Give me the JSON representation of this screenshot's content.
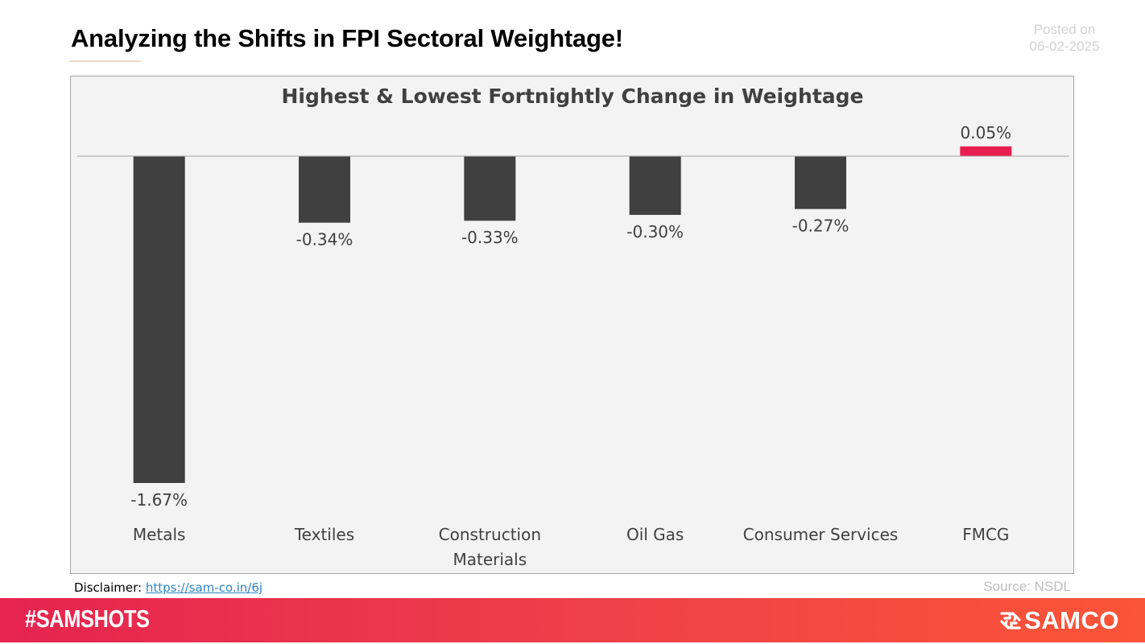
{
  "header": {
    "title": "Analyzing the Shifts in FPI Sectoral Weightage!",
    "posted_label": "Posted on",
    "posted_date": "06-02-2025"
  },
  "chart_data": {
    "type": "bar",
    "title": "Highest & Lowest Fortnightly Change in Weightage",
    "xlabel": "",
    "ylabel": "",
    "categories": [
      "Metals",
      "Textiles",
      "Construction Materials",
      "Oil Gas",
      "Consumer Services",
      "FMCG"
    ],
    "category_lines": [
      [
        "Metals"
      ],
      [
        "Textiles"
      ],
      [
        "Construction",
        "Materials"
      ],
      [
        "Oil Gas"
      ],
      [
        "Consumer Services"
      ],
      [
        "FMCG"
      ]
    ],
    "values": [
      -1.67,
      -0.34,
      -0.33,
      -0.3,
      -0.27,
      0.05
    ],
    "data_labels": [
      "-1.67%",
      "-0.34%",
      "-0.33%",
      "-0.30%",
      "-0.27%",
      "0.05%"
    ],
    "unit": "%",
    "ylim": [
      -1.67,
      0.05
    ],
    "grid": false,
    "legend": "none",
    "colors": {
      "negative": "#404040",
      "positive": "#e91e50",
      "axis": "#a6a6a6"
    }
  },
  "footer": {
    "disclaimer_label": "Disclaimer:",
    "disclaimer_link": "https://sam-co.in/6j",
    "source": "Source: NSDL",
    "hashtag": "#SAMSHOTS",
    "brand": "SAMCO",
    "brand_icon": "samco-logo-icon"
  }
}
